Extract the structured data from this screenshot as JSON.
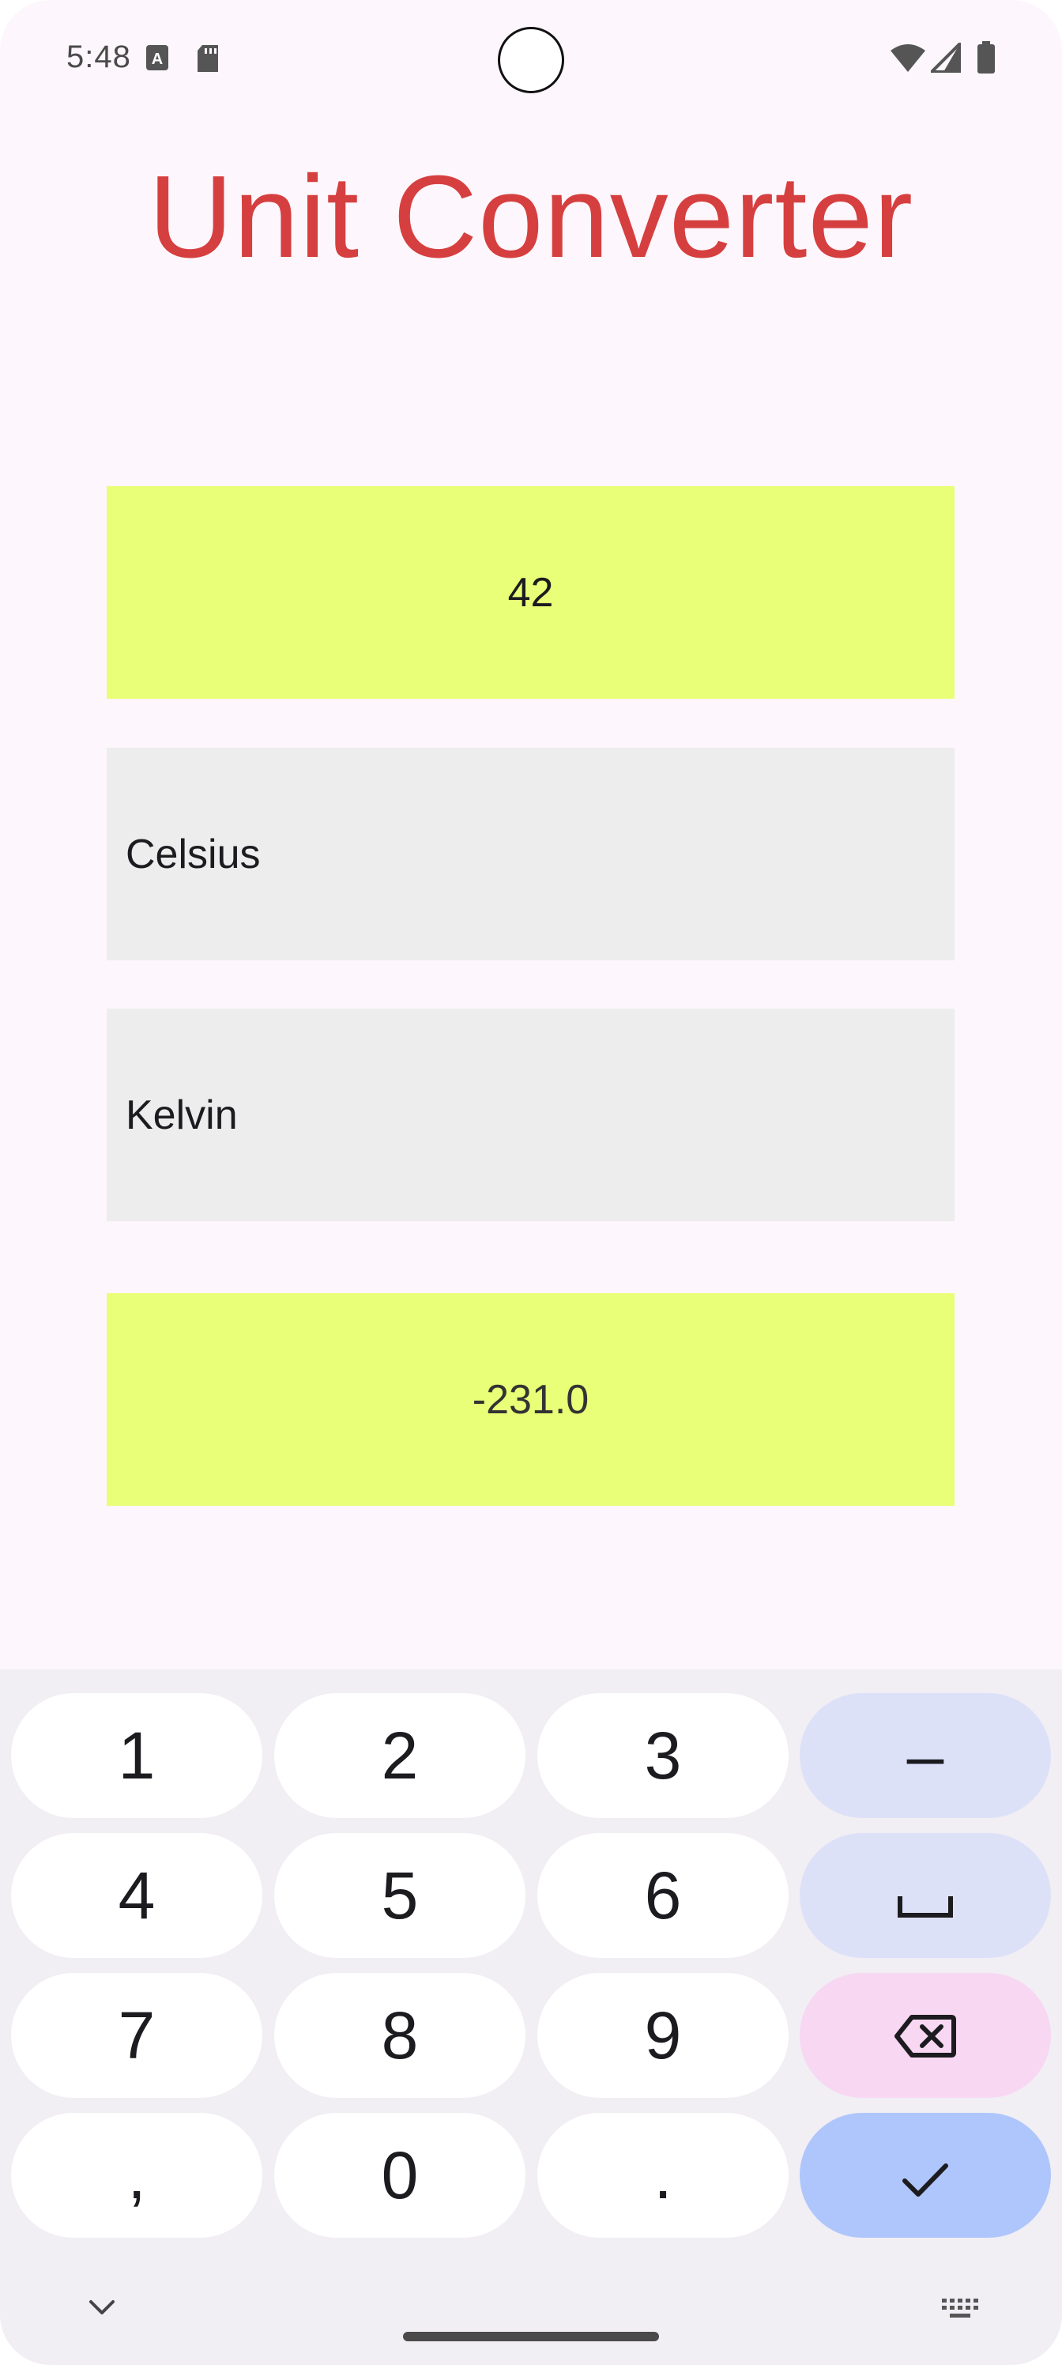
{
  "status_bar": {
    "time": "5:48",
    "icons": [
      "text-a-icon",
      "sd-card-icon",
      "wifi-icon",
      "signal-icon",
      "battery-icon"
    ]
  },
  "app": {
    "title": "Unit Converter",
    "input_value": "42",
    "from_unit": "Celsius",
    "to_unit": "Kelvin",
    "result_value": "-231.0"
  },
  "keyboard": {
    "rows": [
      [
        "1",
        "2",
        "3",
        "–"
      ],
      [
        "4",
        "5",
        "6",
        "space-icon"
      ],
      [
        "7",
        "8",
        "9",
        "backspace-icon"
      ],
      [
        ",",
        "0",
        ".",
        "check-icon"
      ]
    ],
    "key_labels": {
      "k1": "1",
      "k2": "2",
      "k3": "3",
      "minus": "–",
      "k4": "4",
      "k5": "5",
      "k6": "6",
      "k7": "7",
      "k8": "8",
      "k9": "9",
      "comma": ",",
      "k0": "0",
      "period": "."
    },
    "bottom_left_icon": "chevron-down-icon",
    "bottom_right_icon": "keyboard-icon"
  },
  "colors": {
    "title": "#d63f3f",
    "highlight_field": "#e8ff77",
    "select_field": "#ededed",
    "background": "#fdf6fc",
    "keyboard_bg": "#f1eef4",
    "func_key": "#dde1f8",
    "delete_key": "#f8d7f3",
    "enter_key": "#aec6fb"
  }
}
